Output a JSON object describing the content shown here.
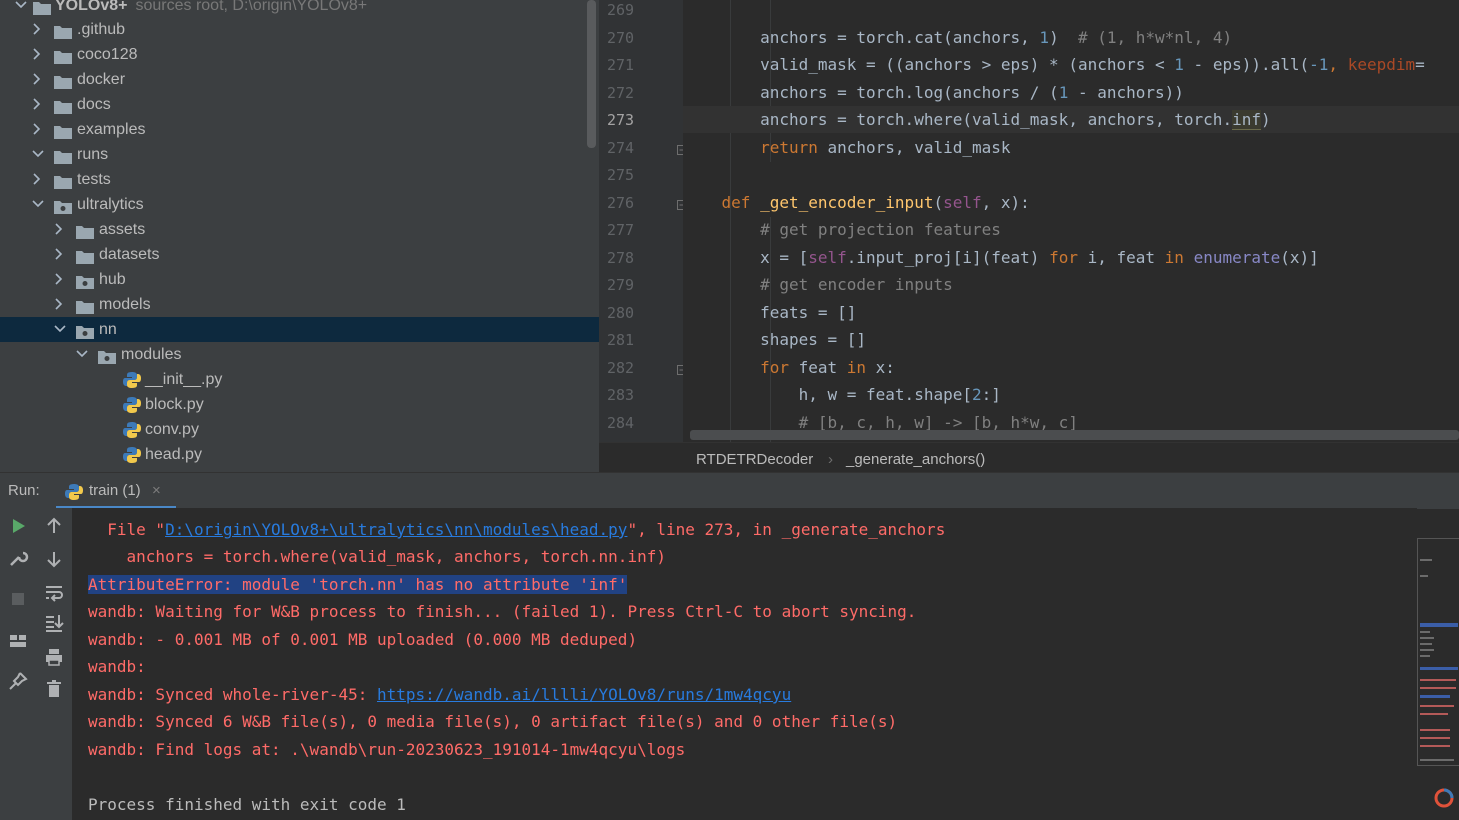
{
  "project_tree": {
    "root": {
      "name": "YOLOv8+",
      "hint": "sources root,  D:\\origin\\YOLOv8+"
    },
    "items": [
      {
        "label": ".github",
        "depth": 1,
        "expanded": false,
        "type": "folder"
      },
      {
        "label": "coco128",
        "depth": 1,
        "expanded": false,
        "type": "folder"
      },
      {
        "label": "docker",
        "depth": 1,
        "expanded": false,
        "type": "folder"
      },
      {
        "label": "docs",
        "depth": 1,
        "expanded": false,
        "type": "folder"
      },
      {
        "label": "examples",
        "depth": 1,
        "expanded": false,
        "type": "folder"
      },
      {
        "label": "runs",
        "depth": 1,
        "expanded": true,
        "type": "folder"
      },
      {
        "label": "tests",
        "depth": 1,
        "expanded": false,
        "type": "folder"
      },
      {
        "label": "ultralytics",
        "depth": 1,
        "expanded": true,
        "type": "package"
      },
      {
        "label": "assets",
        "depth": 2,
        "expanded": false,
        "type": "folder"
      },
      {
        "label": "datasets",
        "depth": 2,
        "expanded": false,
        "type": "folder"
      },
      {
        "label": "hub",
        "depth": 2,
        "expanded": false,
        "type": "package"
      },
      {
        "label": "models",
        "depth": 2,
        "expanded": false,
        "type": "folder"
      },
      {
        "label": "nn",
        "depth": 2,
        "expanded": true,
        "type": "package",
        "selected": true
      },
      {
        "label": "modules",
        "depth": 3,
        "expanded": true,
        "type": "package"
      },
      {
        "label": "__init__.py",
        "depth": 4,
        "type": "python"
      },
      {
        "label": "block.py",
        "depth": 4,
        "type": "python"
      },
      {
        "label": "conv.py",
        "depth": 4,
        "type": "python"
      },
      {
        "label": "head.py",
        "depth": 4,
        "type": "python"
      }
    ]
  },
  "editor": {
    "current_line": "273",
    "line_numbers": [
      "269",
      "270",
      "271",
      "272",
      "273",
      "274",
      "275",
      "276",
      "277",
      "278",
      "279",
      "280",
      "281",
      "282",
      "283",
      "284"
    ],
    "breadcrumbs": [
      "RTDETRDecoder",
      "_generate_anchors()"
    ],
    "breadcrumb_separator": "›",
    "code": {
      "l270": {
        "a": "anchors = torch.cat(anchors, ",
        "b": "1",
        "c": ")  ",
        "d": "# (1, h*w*nl, 4)"
      },
      "l271": {
        "a": "valid_mask = ((anchors > eps) * (anchors < ",
        "b": "1",
        "c": " - eps)).all(",
        "d": "-1",
        "e": ", ",
        "f": "keepdim",
        "g": "="
      },
      "l272": {
        "a": "anchors = torch.log(anchors / (",
        "b": "1",
        "c": " - anchors))"
      },
      "l273": {
        "a": "anchors = torch.where(valid_mask, anchors, torch.",
        "b": "inf",
        "c": ")"
      },
      "l274": {
        "a": "return",
        "b": " anchors, valid_mask"
      },
      "l276": {
        "a": "def ",
        "b": "_get_encoder_input",
        "c": "(",
        "d": "self",
        "e": ", x):"
      },
      "l277": {
        "a": "# get projection features"
      },
      "l278": {
        "a": "x = [",
        "b": "self",
        "c": ".input_proj[i](feat) ",
        "d": "for",
        "e": " i, feat ",
        "f": "in",
        "g": " ",
        "h": "enumerate",
        "i": "(x)]"
      },
      "l279": {
        "a": "# get encoder inputs"
      },
      "l280": {
        "a": "feats = []"
      },
      "l281": {
        "a": "shapes = []"
      },
      "l282": {
        "a": "for",
        "b": " feat ",
        "c": "in",
        "d": " x:"
      },
      "l283": {
        "a": "h, w = feat.shape[",
        "b": "2",
        "c": ":]"
      },
      "l284": {
        "a": "# [b, c, h, w] -> [b, h*w, c]"
      }
    }
  },
  "run_panel": {
    "label": "Run:",
    "tab_label": "train (1)",
    "tab_close": "×",
    "console": {
      "l1_pre": "  File \"",
      "l1_link": "D:\\origin\\YOLOv8+\\ultralytics\\nn\\modules\\head.py",
      "l1_post": "\", line 273, in _generate_anchors",
      "l2": "    anchors = torch.where(valid_mask, anchors, torch.nn.inf)",
      "l3": "AttributeError: module 'torch.nn' has no attribute 'inf'",
      "l4": "wandb: Waiting for W&B process to finish... (failed 1). Press Ctrl-C to abort syncing.",
      "l5": "wandb: - 0.001 MB of 0.001 MB uploaded (0.000 MB deduped)",
      "l6": "wandb: ",
      "l7_pre": "wandb: Synced whole-river-45: ",
      "l7_link": "https://wandb.ai/lllli/YOLOv8/runs/1mw4qcyu",
      "l8": "wandb: Synced 6 W&B file(s), 0 media file(s), 0 artifact file(s) and 0 other file(s)",
      "l9": "wandb: Find logs at: .\\wandb\\run-20230623_191014-1mw4qcyu\\logs",
      "l10": "Process finished with exit code 1"
    }
  },
  "colors": {
    "keyword": "#cc7832",
    "number": "#6897bb",
    "comment": "#808080",
    "error_text": "#ff6b68",
    "link": "#287bde",
    "selection": "#214283"
  }
}
